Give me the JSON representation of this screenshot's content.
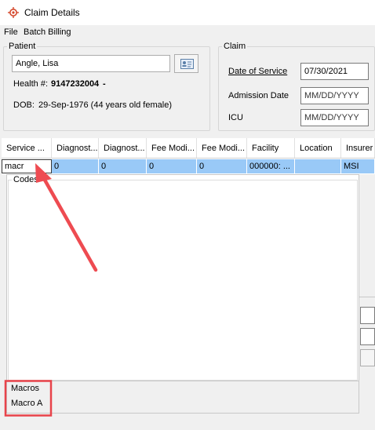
{
  "window": {
    "title": "Claim Details",
    "icon": "target-icon"
  },
  "menu": {
    "items": [
      "File",
      "Batch Billing"
    ]
  },
  "patient": {
    "legend": "Patient",
    "name": "Angle, Lisa",
    "health_label": "Health #:",
    "health_number": "9147232004",
    "health_suffix": "-",
    "dob_label": "DOB:",
    "dob_value": "29-Sep-1976 (44 years old female)"
  },
  "claim": {
    "legend": "Claim",
    "date_of_service_label": "Date of Service",
    "date_of_service_value": "07/30/2021",
    "admission_date_label": "Admission Date",
    "admission_date_placeholder": "MM/DD/YYYY",
    "icu_label": "ICU",
    "icu_placeholder": "MM/DD/YYYY"
  },
  "grid": {
    "columns": [
      "Service ...",
      "Diagnost...",
      "Diagnost...",
      "Fee Modi...",
      "Fee Modi...",
      "Facility",
      "Location",
      "Insurer"
    ],
    "row": [
      "macr",
      "0",
      "0",
      "0",
      "0",
      "000000: ...",
      "",
      "MSI"
    ]
  },
  "codes": {
    "legend": "Codes"
  },
  "macros": {
    "legend": "Macros",
    "items": [
      "Macro A"
    ]
  },
  "colors": {
    "selection": "#99c9f7",
    "highlight_box": "#e8434a",
    "arrow": "#ee4b51"
  }
}
